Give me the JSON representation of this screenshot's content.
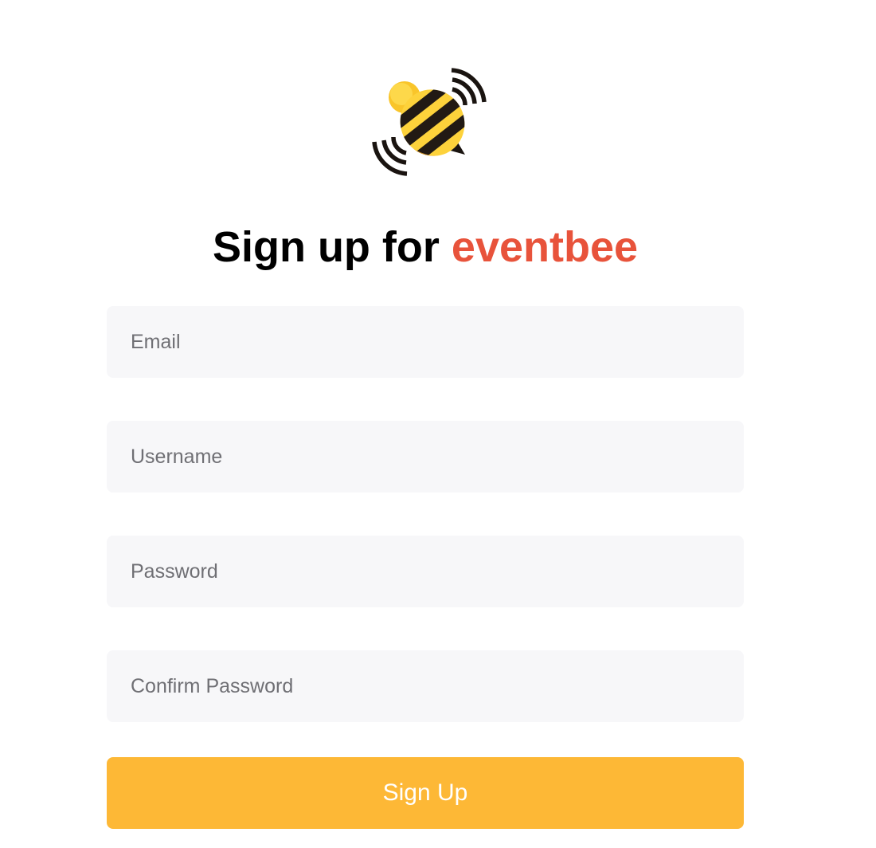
{
  "brand": {
    "logo_icon": "bee-logo-icon",
    "accent_color": "#e8533b",
    "button_color": "#fdb836"
  },
  "heading": {
    "prefix": "Sign up for ",
    "brand_name": "eventbee"
  },
  "form": {
    "email_placeholder": "Email",
    "username_placeholder": "Username",
    "password_placeholder": "Password",
    "confirm_password_placeholder": "Confirm Password",
    "submit_label": "Sign Up"
  }
}
